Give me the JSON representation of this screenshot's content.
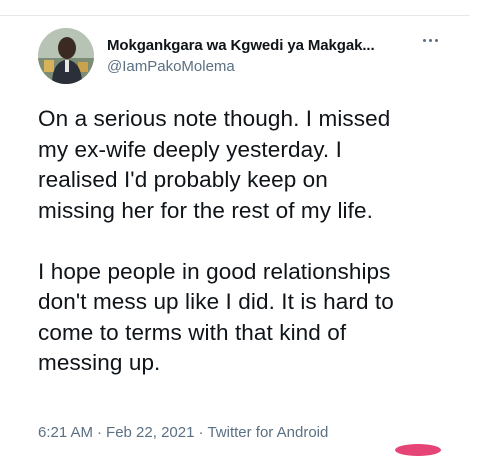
{
  "tweet": {
    "display_name": "Mokgankgara wa Kgwedi ya Makgak...",
    "handle": "@IamPakoMolema",
    "paragraph1": [
      "On a serious note though. I missed",
      "my ex-wife deeply yesterday. I",
      "realised I'd probably keep on",
      "missing her for the rest of my life."
    ],
    "paragraph2": [
      "I hope people in good relationships",
      "don't mess up like I did. It is hard to",
      "come to terms with that kind of",
      "messing up."
    ],
    "time": "6:21 AM",
    "date": "Feb 22, 2021",
    "source": "Twitter for Android",
    "separator": "·"
  },
  "icons": {
    "more": "more-horizontal-icon",
    "avatar": "profile-photo"
  },
  "colors": {
    "text": "#0f1419",
    "secondary": "#5b7083",
    "accent": "#e0245e"
  }
}
